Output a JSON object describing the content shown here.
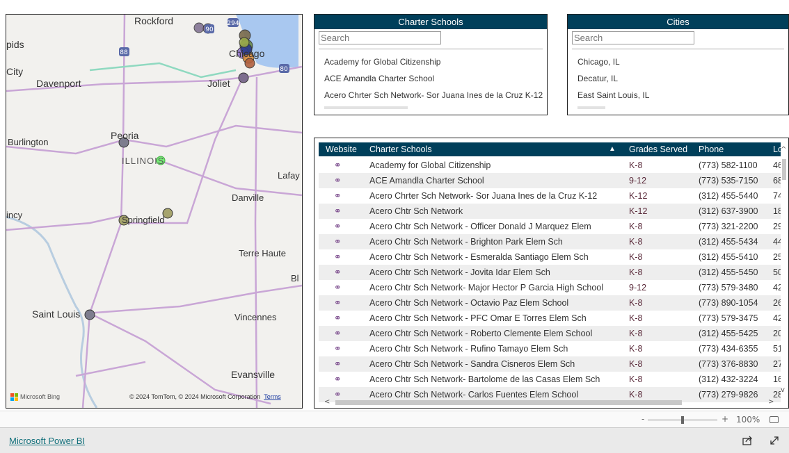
{
  "map": {
    "labels": {
      "rockford": "Rockford",
      "rapids": "pids",
      "city": "City",
      "davenport": "Davenport",
      "joliet": "Joliet",
      "chicago": "Chicago",
      "peoria": "Peoria",
      "burlington": "Burlington",
      "illinois": "ILLINOIS",
      "lafayette": "Lafay",
      "danville": "Danville",
      "quincy": "incy",
      "springfield": "Springfield",
      "terre_haute": "Terre Haute",
      "bl": "Bl",
      "saint_louis": "Saint Louis",
      "vincennes": "Vincennes",
      "evansville": "Evansville"
    },
    "shields": {
      "i294": "294",
      "i90": "90",
      "i88": "88",
      "i80": "80"
    },
    "bing_label": "Microsoft Bing",
    "copyright": "© 2024 TomTom, © 2024 Microsoft Corporation",
    "terms": "Terms",
    "colors": {
      "water": "#a9c8f0",
      "road": "#c9a6d6",
      "highway": "#8fd9c0",
      "marker": "#6b5d7e"
    }
  },
  "charter_slicer": {
    "title": "Charter Schools",
    "search_placeholder": "Search",
    "items": [
      "Academy for Global Citizenship",
      "ACE Amandla Charter School",
      "Acero Chrter Sch Network- Sor Juana Ines de la Cruz K-12"
    ]
  },
  "city_slicer": {
    "title": "Cities",
    "search_placeholder": "Search",
    "items": [
      "Chicago, IL",
      "Decatur, IL",
      "East Saint Louis, IL"
    ]
  },
  "table": {
    "headers": {
      "website": "Website",
      "school": "Charter Schools",
      "grades": "Grades Served",
      "phone": "Phone",
      "loc": "Lo"
    },
    "sort": "ascending",
    "rows": [
      {
        "school": "Academy for Global Citizenship",
        "grades": "K-8",
        "phone": "(773) 582-1100",
        "loc": "46"
      },
      {
        "school": "ACE Amandla Charter School",
        "grades": "9-12",
        "phone": "(773) 535-7150",
        "loc": "68"
      },
      {
        "school": "Acero Chrter Sch Network- Sor Juana Ines de la Cruz K-12",
        "grades": "K-12",
        "phone": "(312) 455-5440",
        "loc": "74"
      },
      {
        "school": "Acero Chtr Sch Network",
        "grades": "K-12",
        "phone": "(312) 637-3900",
        "loc": "18"
      },
      {
        "school": "Acero Chtr Sch Network -  Officer Donald J Marquez Elem",
        "grades": "K-8",
        "phone": "(773) 321-2200",
        "loc": "29"
      },
      {
        "school": "Acero Chtr Sch Network - Brighton Park Elem Sch",
        "grades": "K-8",
        "phone": "(312) 455-5434",
        "loc": "44"
      },
      {
        "school": "Acero Chtr Sch Network - Esmeralda Santiago Elem Sch",
        "grades": "K-8",
        "phone": "(312) 455-5410",
        "loc": "25"
      },
      {
        "school": "Acero Chtr Sch Network - Jovita Idar Elem Sch",
        "grades": "K-8",
        "phone": "(312) 455-5450",
        "loc": "50"
      },
      {
        "school": "Acero Chtr Sch Network-  Major Hector P Garcia High School",
        "grades": "9-12",
        "phone": "(773) 579-3480",
        "loc": "42"
      },
      {
        "school": "Acero Chtr Sch Network - Octavio Paz Elem School",
        "grades": "K-8",
        "phone": "(773) 890-1054",
        "loc": "26"
      },
      {
        "school": "Acero Chtr Sch Network - PFC Omar E Torres Elem Sch",
        "grades": "K-8",
        "phone": "(773) 579-3475",
        "loc": "42"
      },
      {
        "school": "Acero Chtr Sch Network - Roberto Clemente Elem School",
        "grades": "K-8",
        "phone": "(312) 455-5425",
        "loc": "20"
      },
      {
        "school": "Acero Chtr Sch Network - Rufino Tamayo Elem Sch",
        "grades": "K-8",
        "phone": "(773) 434-6355",
        "loc": "51"
      },
      {
        "school": "Acero Chtr Sch Network - Sandra Cisneros Elem Sch",
        "grades": "K-8",
        "phone": "(773) 376-8830",
        "loc": "27"
      },
      {
        "school": "Acero Chtr Sch Network- Bartolome de las Casas Elem Sch",
        "grades": "K-8",
        "phone": "(312) 432-3224",
        "loc": "16"
      },
      {
        "school": "Acero Chtr Sch Network- Carlos Fuentes Elem School",
        "grades": "K-8",
        "phone": "(773) 279-9826",
        "loc": "28"
      }
    ]
  },
  "zoom": {
    "minus": "-",
    "plus": "+",
    "level": "100%",
    "level_percent": 100
  },
  "footer": {
    "brand": "Microsoft Power BI"
  }
}
